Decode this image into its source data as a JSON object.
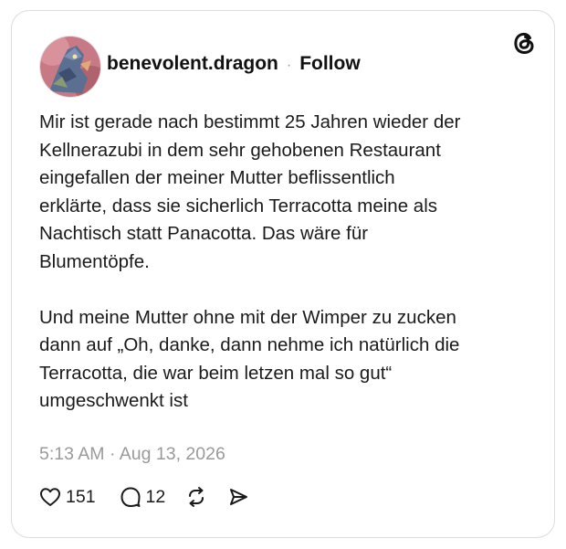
{
  "post": {
    "username": "benevolent.dragon",
    "separator": "·",
    "follow_label": "Follow",
    "text": "Mir ist gerade nach bestimmt 25 Jahren wieder der\nKellnerazubi in dem sehr gehobenen Restaurant\neingefallen der meiner Mutter beflissentlich\nerklärte, dass sie sicherlich Terracotta meine als\nNachtisch statt Panacotta. Das wäre für\nBlumentöpfe.\n\nUnd meine Mutter ohne mit der Wimper zu zucken\ndann auf „Oh, danke, dann nehme ich natürlich die\nTerracotta, die war beim letzen mal so gut“\numgeschwenkt ist",
    "timestamp": "5:13 AM · Aug 13, 2026",
    "likes": "151",
    "replies": "12"
  },
  "icons": {
    "logo": "threads-logo-icon",
    "like": "heart-icon",
    "reply": "speech-bubble-icon",
    "repost": "repost-arrows-icon",
    "share": "send-icon"
  },
  "colors": {
    "text": "#1a1a1a",
    "muted": "#9a9a9a",
    "border": "#dcdcdc"
  }
}
